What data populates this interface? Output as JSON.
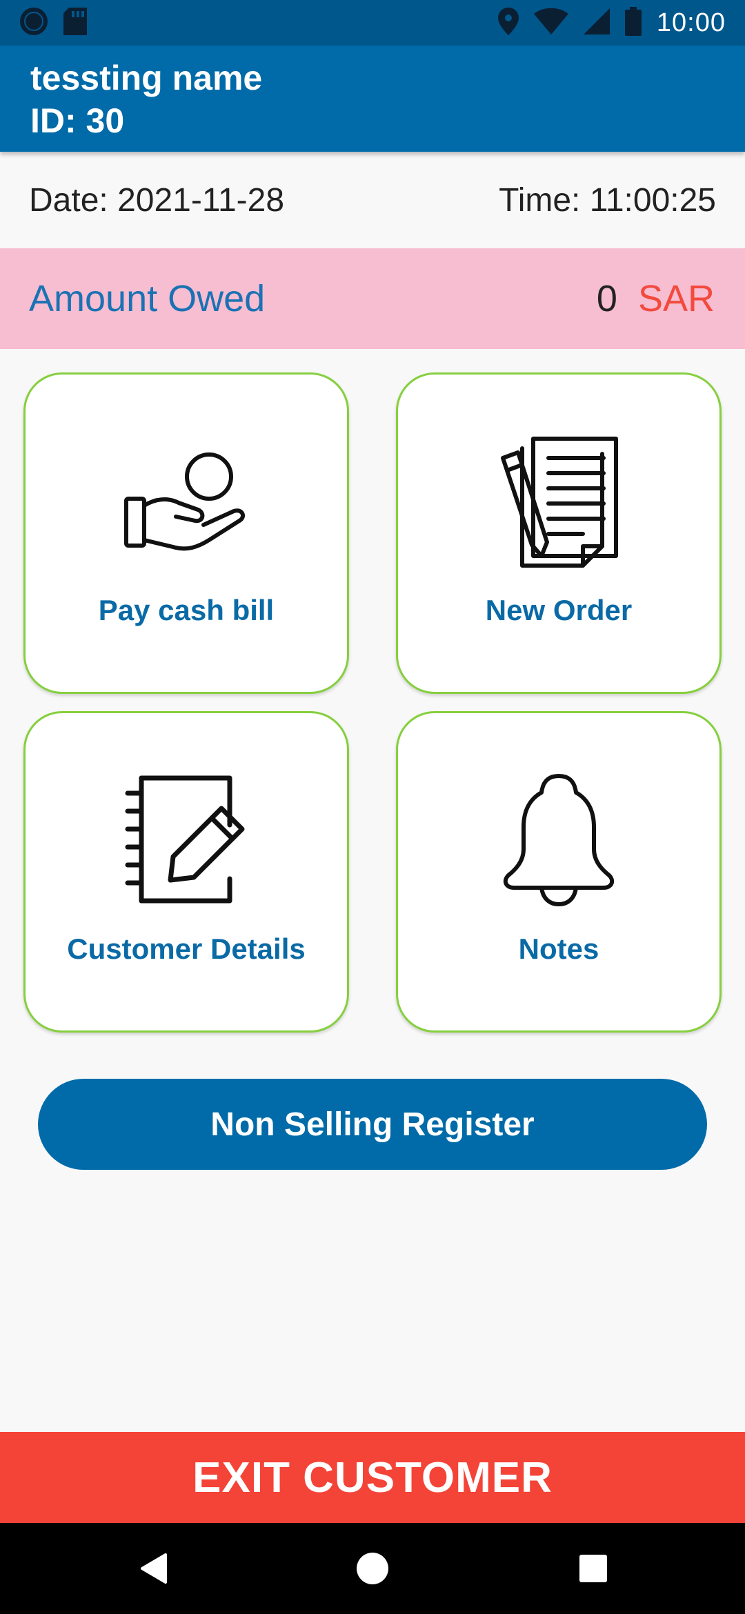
{
  "status_bar": {
    "time": "10:00",
    "icons": [
      "record-icon",
      "sd-card-icon",
      "location-icon",
      "wifi-icon",
      "cell-signal-icon",
      "battery-icon"
    ]
  },
  "header": {
    "name": "tessting name",
    "id": "ID: 30"
  },
  "info": {
    "date": "Date: 2021-11-28",
    "time": "Time: 11:00:25"
  },
  "amount_owed": {
    "label": "Amount Owed",
    "value": "0",
    "currency": "SAR"
  },
  "tiles": [
    {
      "label": "Pay cash bill",
      "icon": "hand-coin-icon"
    },
    {
      "label": "New Order",
      "icon": "order-document-icon"
    },
    {
      "label": "Customer Details",
      "icon": "notebook-edit-icon"
    },
    {
      "label": "Notes",
      "icon": "bell-icon"
    }
  ],
  "buttons": {
    "non_selling_register": "Non Selling Register",
    "exit_customer": "EXIT CUSTOMER"
  },
  "colors": {
    "primary": "#006ba8",
    "status_bar": "#00578c",
    "owed_background": "#f7bdd1",
    "currency": "#f24a3d",
    "tile_border": "#86cf3e",
    "exit": "#f44337"
  }
}
